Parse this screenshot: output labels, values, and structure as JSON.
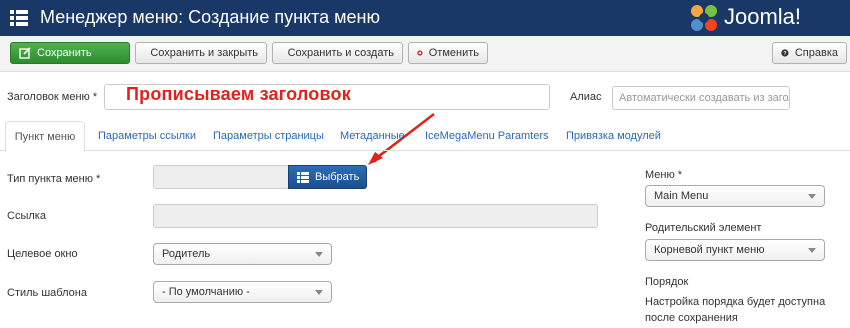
{
  "header": {
    "title": "Менеджер меню: Создание пункта меню",
    "brand": "Joomla!"
  },
  "toolbar": {
    "save": "Сохранить",
    "save_close": "Сохранить и закрыть",
    "save_new": "Сохранить и создать",
    "cancel": "Отменить",
    "help": "Справка"
  },
  "title_row": {
    "label": "Заголовок меню *",
    "annotation": "Прописываем  заголовок",
    "alias_label": "Алиас",
    "alias_placeholder": "Автоматически создавать из загол"
  },
  "tabs": [
    {
      "label": "Пункт меню"
    },
    {
      "label": "Параметры ссылки"
    },
    {
      "label": "Параметры страницы"
    },
    {
      "label": "Метаданные"
    },
    {
      "label": "IceMegaMenu Paramters"
    },
    {
      "label": "Привязка модулей"
    }
  ],
  "form": {
    "type_label": "Тип пункта меню *",
    "select_button": "Выбрать",
    "link_label": "Ссылка",
    "target_label": "Целевое окно",
    "target_value": "Родитель",
    "template_label": "Стиль шаблона",
    "template_value": "- По умолчанию -"
  },
  "sidebar": {
    "menu_label": "Меню *",
    "menu_value": "Main Menu",
    "parent_label": "Родительский элемент",
    "parent_value": "Корневой пункт меню",
    "order_label": "Порядок",
    "order_note": "Настройка порядка будет доступна после сохранения"
  },
  "colors": {
    "header_bg": "#1a3867",
    "success": "#3c9a3c",
    "primary": "#2262a8",
    "annotation": "#e0211c",
    "link": "#2a69b8"
  }
}
